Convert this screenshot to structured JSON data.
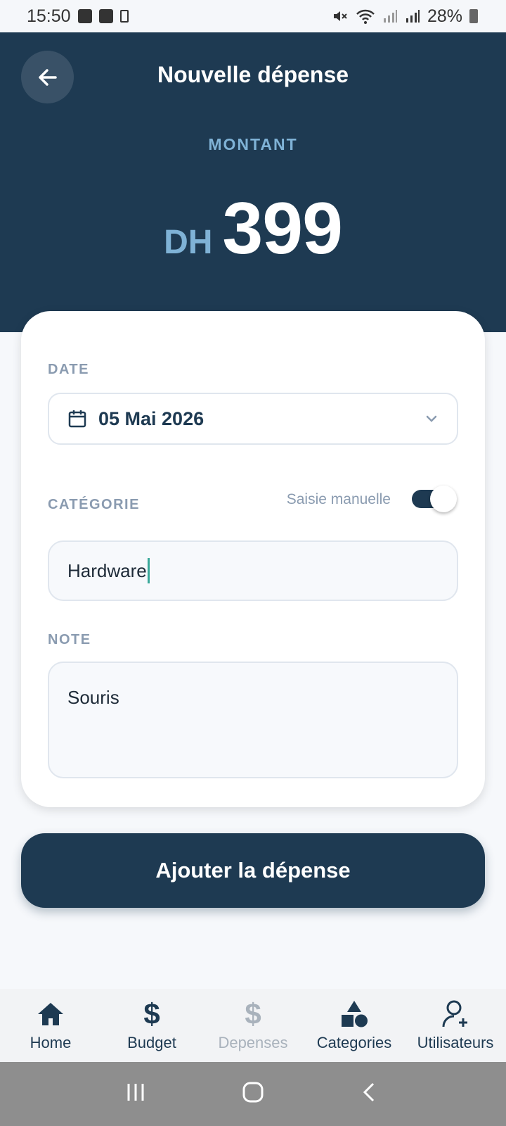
{
  "status_bar": {
    "time": "15:50",
    "battery": "28%"
  },
  "header": {
    "title": "Nouvelle dépense",
    "amount_label": "MONTANT",
    "currency": "DH",
    "amount": "399"
  },
  "form": {
    "date_label": "DATE",
    "date_value": "05 Mai 2026",
    "category_label": "CATÉGORIE",
    "manual_entry_label": "Saisie manuelle",
    "manual_entry_enabled": true,
    "category_value": "Hardware",
    "note_label": "NOTE",
    "note_value": "Souris"
  },
  "submit_label": "Ajouter la dépense",
  "nav": {
    "items": [
      {
        "label": "Home",
        "icon": "home-icon",
        "active": true
      },
      {
        "label": "Budget",
        "icon": "dollar-icon",
        "active": true
      },
      {
        "label": "Depenses",
        "icon": "dollar-icon",
        "active": false
      },
      {
        "label": "Categories",
        "icon": "shapes-icon",
        "active": true
      },
      {
        "label": "Utilisateurs",
        "icon": "add-user-icon",
        "active": true
      }
    ]
  },
  "colors": {
    "primary": "#1e3a52",
    "accent": "#7fb2d6",
    "muted": "#8a9bb0"
  }
}
